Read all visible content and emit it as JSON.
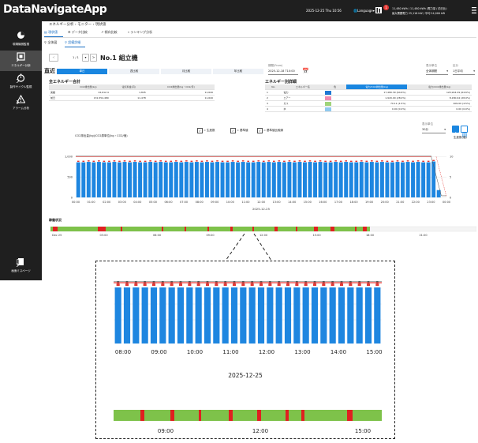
{
  "header": {
    "logo": "DataNavigateApp",
    "datetime": "2025-12-25 Thu 10:56",
    "language": "Language",
    "notification_count": "1",
    "line1": "11,480 kWh / 11,480 kWh (電力量 / 前日比)",
    "line2": "最大需要電力 25,116 kW / 平均 24,000 kW"
  },
  "sidebar": {
    "items": [
      {
        "label": "現場機械監視",
        "icon": "dashboard-icon"
      },
      {
        "label": "エネルギー分析",
        "icon": "energy-icon"
      },
      {
        "label": "製作サイクル監視",
        "icon": "cycle-icon"
      },
      {
        "label": "アラーム分析",
        "icon": "alarm-icon"
      },
      {
        "label": "画面ミスページ",
        "icon": "document-icon"
      }
    ]
  },
  "breadcrumb": "エネルギー分析 › モニター › 現状値",
  "tabs": [
    "現状値",
    "データ比較",
    "傾向比較",
    "ランキング分析"
  ],
  "subtabs": [
    "全体図",
    "設備詳細"
  ],
  "toolbar": {
    "page_value": "1 / 1",
    "title": "No.1 組立機"
  },
  "periods": [
    "直近",
    "単日",
    "週比較",
    "月比較",
    "年比較"
  ],
  "date_label": "期間(From)",
  "date_value": "2025-12-18 T10:00",
  "dd1_label": "表示単位",
  "dd1_value": "全体期間",
  "dd2_label": "区分",
  "dd2_value": "1日平均",
  "energy_total": {
    "title": "全エネルギー合計",
    "headers": [
      "",
      "CO2排出量(kg)",
      "電気料金(円)",
      "CO2排出量(kg・CO2/月)"
    ],
    "rows": [
      [
        "実績",
        "22,612.4",
        "1,845",
        "11,640"
      ],
      [
        "前日",
        "131,554,480",
        "11,478",
        "11,640"
      ]
    ]
  },
  "energy_detail": {
    "title": "エネルギー別詳細",
    "headers": [
      "No.",
      "エネルギー名",
      "色",
      "電力/CO2排出量(kg)",
      "電力/CO2排出量(kg)"
    ],
    "rows": [
      {
        "no": "1",
        "name": "電力",
        "color": "#1e78d4",
        "v1": "17,480.39 (64.6%)",
        "v2": "120,944.29 (64.6%)"
      },
      {
        "no": "2",
        "name": "エアー",
        "color": "#f08ab0",
        "v1": "1,920.00 (28.0%)",
        "v2": "8,180.94 (28.0%)"
      },
      {
        "no": "3",
        "name": "ガス",
        "color": "#9fd47a",
        "v1": "70.11 (4.5%)",
        "v2": "409.00 (4.5%)"
      },
      {
        "no": "4",
        "name": "水",
        "color": "#8fc9ee",
        "v1": "0.00 (0.0%)",
        "v2": "0.00 (0.0%)"
      }
    ]
  },
  "chart_controls": {
    "legend_checks": [
      "= 生産数",
      "= 基準値",
      "= 基準値比較線"
    ],
    "unit_label": "表示単位",
    "unit_value": "30分",
    "ylabel_left": "CO2排出量(kg)/CO2原単位(kg・CO2/個)",
    "ylabel_right": "生産数(個)"
  },
  "chart_data": {
    "type": "bar",
    "x_label": "2025-12-25",
    "x_ticks": [
      "00:00",
      "01:00",
      "02:00",
      "03:00",
      "04:00",
      "05:00",
      "06:00",
      "07:00",
      "08:00",
      "09:00",
      "10:00",
      "11:00",
      "12:00",
      "13:00",
      "14:00",
      "15:00",
      "16:00",
      "17:00",
      "18:00",
      "19:00",
      "20:00",
      "21:00",
      "22:00",
      "23:00",
      "00:00"
    ],
    "y_ticks_left": [
      "1,000",
      "500",
      "0"
    ],
    "y_ticks_right": [
      "10",
      "5",
      "0"
    ],
    "ylim": [
      0,
      1200
    ],
    "values": [
      860,
      860,
      870,
      860,
      870,
      860,
      860,
      870,
      860,
      870,
      860,
      870,
      860,
      860,
      870,
      860,
      870,
      860,
      860,
      870,
      860,
      870,
      860,
      870,
      860,
      870,
      860,
      870,
      860,
      860,
      870,
      860,
      870,
      860,
      860,
      870,
      860,
      870,
      860,
      870,
      860,
      870,
      860,
      870,
      860,
      870,
      860,
      870,
      860,
      860,
      870,
      860,
      870,
      860,
      860,
      870,
      860,
      870,
      860,
      870,
      860,
      860,
      870,
      860,
      870,
      860,
      870,
      860,
      860,
      880,
      180,
      0
    ],
    "reference": 1000
  },
  "operation": {
    "title": "稼働状況",
    "labels": [
      "Dec 25",
      "03:00",
      "06:00",
      "09:00",
      "12:00",
      "15:00",
      "18:00",
      "21:00"
    ],
    "colors": {
      "run": "#7ec24a",
      "stop": "#e02020",
      "none": "#f4f4f4"
    }
  },
  "zoom": {
    "x_ticks": [
      "08:00",
      "09:00",
      "10:00",
      "11:00",
      "12:00",
      "13:00",
      "14:00",
      "15:00"
    ],
    "date": "2025-12-25",
    "op_labels": [
      "09:00",
      "12:00",
      "15:00"
    ]
  }
}
